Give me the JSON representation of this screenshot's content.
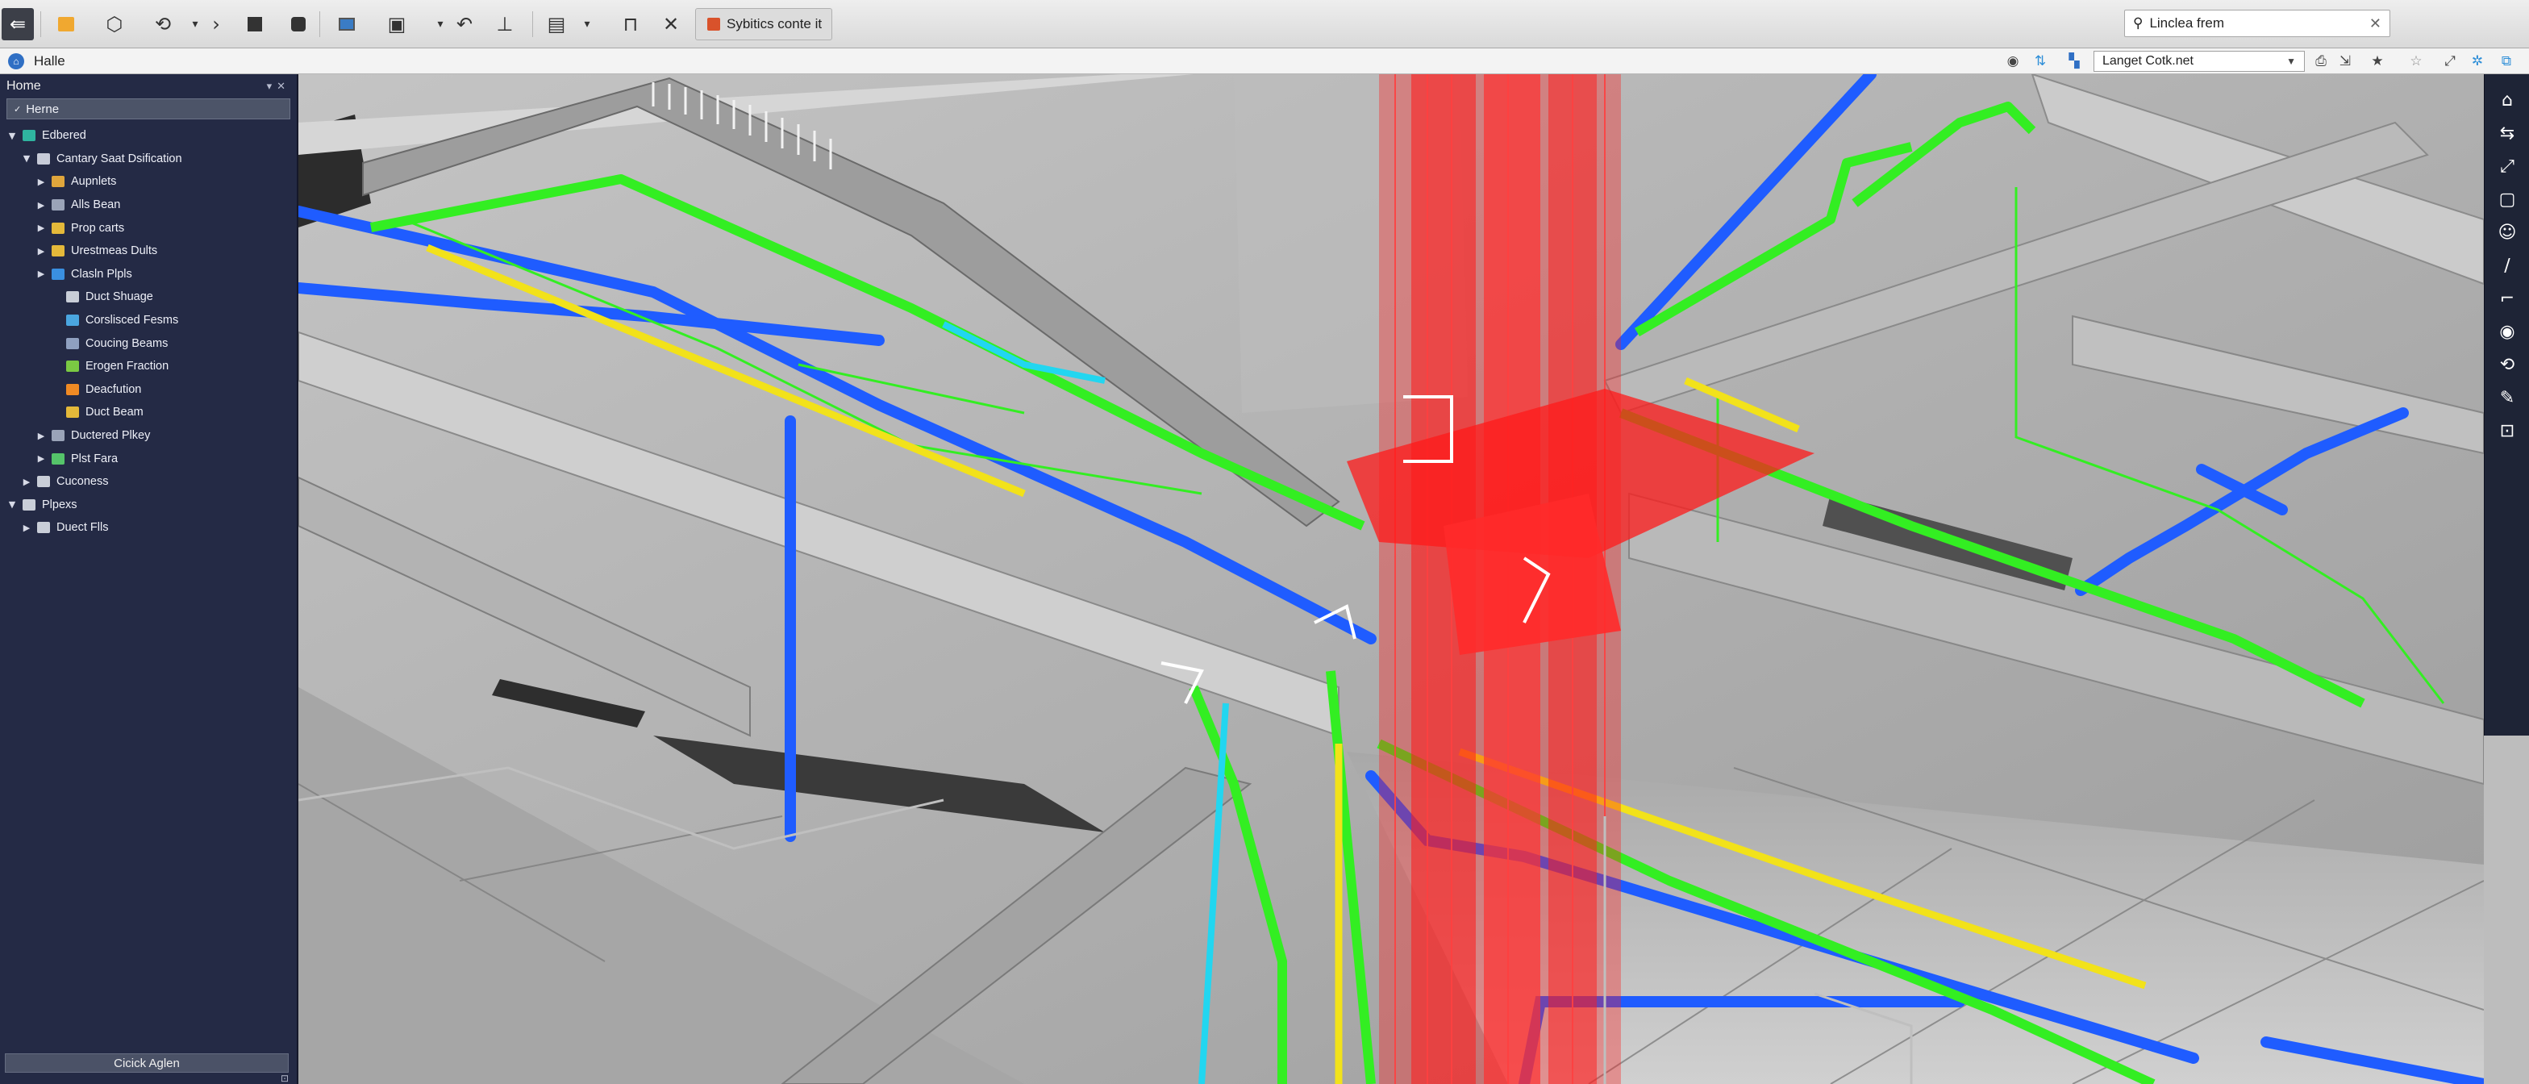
{
  "toolbar": {
    "document_tab": "Sybitics conte it",
    "search": {
      "value": "Linclea frem"
    }
  },
  "address_bar": {
    "location_label": "Halle",
    "source_select": "Langet Cotk.net"
  },
  "browser_panel": {
    "title": "Home",
    "filter_value": "Herne",
    "footer_button": "Cicick Aglen",
    "tree": [
      {
        "label": "Edbered",
        "depth": 0,
        "state": "expanded",
        "icon": "folder-icon",
        "color": "#2fb5a0"
      },
      {
        "label": "Cantary Saat Dsification",
        "depth": 1,
        "state": "expanded",
        "icon": "family-icon",
        "color": "#c7cbd8"
      },
      {
        "label": "Aupnlets",
        "depth": 2,
        "state": "collapsed",
        "icon": "equipment-icon",
        "color": "#e0a63c"
      },
      {
        "label": "Alls Bean",
        "depth": 2,
        "state": "collapsed",
        "icon": "beam-icon",
        "color": "#9aa3b8"
      },
      {
        "label": "Prop carts",
        "depth": 2,
        "state": "collapsed",
        "icon": "folder-icon",
        "color": "#e4b93a"
      },
      {
        "label": "Urestmeas Dults",
        "depth": 2,
        "state": "collapsed",
        "icon": "folder-icon",
        "color": "#e4b93a"
      },
      {
        "label": "Clasln Plpls",
        "depth": 2,
        "state": "collapsed",
        "icon": "pipe-icon",
        "color": "#3a8fe0"
      },
      {
        "label": "Duct Shuage",
        "depth": 3,
        "state": "none",
        "icon": "duct-icon",
        "color": "#c9ced8"
      },
      {
        "label": "Corslisced Fesms",
        "depth": 3,
        "state": "none",
        "icon": "member-icon",
        "color": "#4aa6e0"
      },
      {
        "label": "Coucing Beams",
        "depth": 3,
        "state": "none",
        "icon": "beam-icon",
        "color": "#8fa0c0"
      },
      {
        "label": "Erogen Fraction",
        "depth": 3,
        "state": "none",
        "icon": "fitting-icon",
        "color": "#7ac943"
      },
      {
        "label": "Deacfution",
        "depth": 3,
        "state": "none",
        "icon": "fitting-icon",
        "color": "#f08a24"
      },
      {
        "label": "Duct Beam",
        "depth": 3,
        "state": "none",
        "icon": "beam-icon",
        "color": "#e4b93a"
      },
      {
        "label": "Ductered Plkey",
        "depth": 2,
        "state": "collapsed",
        "icon": "duct-icon",
        "color": "#9aa3b8"
      },
      {
        "label": "Plst Fara",
        "depth": 2,
        "state": "collapsed",
        "icon": "fitting-icon",
        "color": "#55c46a"
      },
      {
        "label": "Cuconess",
        "depth": 1,
        "state": "collapsed",
        "icon": "category-icon",
        "color": "#c9ced8"
      },
      {
        "label": "Plpexs",
        "depth": 0,
        "state": "expanded",
        "icon": "view-icon",
        "color": "#c9ced8"
      },
      {
        "label": "Duect Flls",
        "depth": 1,
        "state": "collapsed",
        "icon": "view-icon",
        "color": "#c9ced8"
      }
    ]
  },
  "palette": [
    {
      "icon": "home-icon",
      "glyph": "⌂"
    },
    {
      "icon": "connect-icon",
      "glyph": "⇆"
    },
    {
      "icon": "scale-icon",
      "glyph": "⤢"
    },
    {
      "icon": "square-icon",
      "glyph": "▢"
    },
    {
      "icon": "user-icon",
      "glyph": "☺"
    },
    {
      "icon": "line-icon",
      "glyph": "∕"
    },
    {
      "icon": "duct-elbow-icon",
      "glyph": "⌐"
    },
    {
      "icon": "pipe-fitting-icon",
      "glyph": "◉"
    },
    {
      "icon": "rotate-icon",
      "glyph": "⟲"
    },
    {
      "icon": "pencil-icon",
      "glyph": "✎"
    },
    {
      "icon": "camera-icon",
      "glyph": "⊡"
    }
  ],
  "colors": {
    "mep_red": "#ff1a1a",
    "mep_green": "#33ee22",
    "mep_blue": "#1f5cff",
    "mep_yellow": "#f2e21a",
    "mep_cyan": "#22d6f0",
    "panel_bg": "#242a45"
  }
}
